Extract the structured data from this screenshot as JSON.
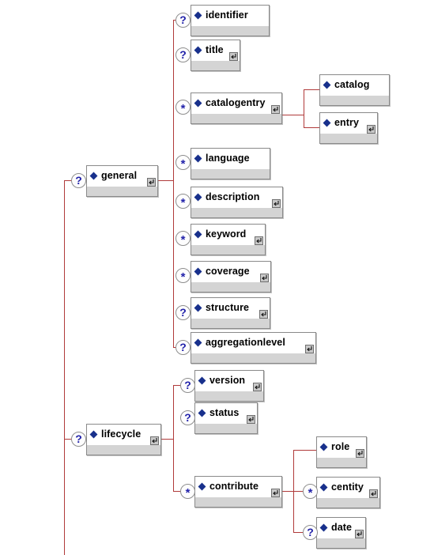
{
  "diagram": {
    "title": "LOM XSD element tree",
    "accent_line_color": "#b03a3a",
    "node_fill": "#ffffff",
    "node_footer_fill": "#d4d4d4",
    "diamond_color": "#18308c",
    "occurrence_text_color": "#2222aa"
  },
  "icons": {
    "element_marker": "blue-diamond-icon",
    "expander": "expand-arrow-icon",
    "optional": "question-mark-icon",
    "repeatable": "asterisk-icon"
  },
  "nodes": [
    {
      "id": "general",
      "label": "general",
      "occurrence": "?",
      "expander": true
    },
    {
      "id": "identifier",
      "label": "identifier",
      "occurrence": "?",
      "expander": false
    },
    {
      "id": "title",
      "label": "title",
      "occurrence": "?",
      "expander": true
    },
    {
      "id": "catalogentry",
      "label": "catalogentry",
      "occurrence": "*",
      "expander": true
    },
    {
      "id": "catalog",
      "label": "catalog",
      "occurrence": "",
      "expander": false
    },
    {
      "id": "entry",
      "label": "entry",
      "occurrence": "",
      "expander": true
    },
    {
      "id": "language",
      "label": "language",
      "occurrence": "*",
      "expander": false
    },
    {
      "id": "description",
      "label": "description",
      "occurrence": "*",
      "expander": true
    },
    {
      "id": "keyword",
      "label": "keyword",
      "occurrence": "*",
      "expander": true
    },
    {
      "id": "coverage",
      "label": "coverage",
      "occurrence": "*",
      "expander": true
    },
    {
      "id": "structure",
      "label": "structure",
      "occurrence": "?",
      "expander": true
    },
    {
      "id": "aggregationlevel",
      "label": "aggregationlevel",
      "occurrence": "?",
      "expander": true
    },
    {
      "id": "lifecycle",
      "label": "lifecycle",
      "occurrence": "?",
      "expander": true
    },
    {
      "id": "version",
      "label": "version",
      "occurrence": "?",
      "expander": true
    },
    {
      "id": "status",
      "label": "status",
      "occurrence": "?",
      "expander": true
    },
    {
      "id": "contribute",
      "label": "contribute",
      "occurrence": "*",
      "expander": true
    },
    {
      "id": "role",
      "label": "role",
      "occurrence": "",
      "expander": true
    },
    {
      "id": "centity",
      "label": "centity",
      "occurrence": "*",
      "expander": true
    },
    {
      "id": "date",
      "label": "date",
      "occurrence": "?",
      "expander": true
    }
  ]
}
